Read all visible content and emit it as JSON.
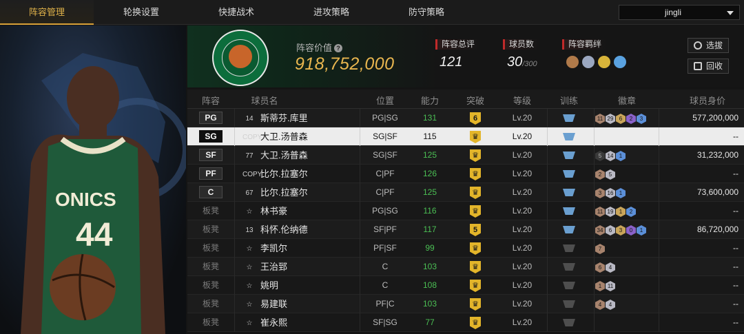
{
  "nav": {
    "tabs": [
      {
        "label": "阵容管理",
        "active": true
      },
      {
        "label": "轮换设置",
        "active": false
      },
      {
        "label": "快捷战术",
        "active": false
      },
      {
        "label": "进攻策略",
        "active": false
      },
      {
        "label": "防守策略",
        "active": false
      }
    ],
    "user": "jingli"
  },
  "header": {
    "value_label": "阵容价值",
    "value": "918,752,000",
    "rating_label": "阵容总评",
    "rating": "121",
    "players_label": "球员数",
    "players": "30",
    "players_max": "/300",
    "bond_label": "阵容羁绊",
    "select_button": "选拔",
    "recycle_button": "回收"
  },
  "table": {
    "headers": [
      "阵容",
      "球员名",
      "位置",
      "能力",
      "突破",
      "等级",
      "训练",
      "徽章",
      "球员身价"
    ],
    "rows": [
      {
        "slot": "PG",
        "starter": true,
        "card": "14",
        "name": "斯蒂芬.库里",
        "role": "PG|SG",
        "ability": "131",
        "ability_color": "green",
        "breakthrough": "6",
        "level": "Lv.20",
        "train": "blue",
        "badges": [
          {
            "c": "bronze",
            "n": "11"
          },
          {
            "c": "silver",
            "n": "29"
          },
          {
            "c": "gold",
            "n": "6"
          },
          {
            "c": "purple",
            "n": "2"
          },
          {
            "c": "blue",
            "n": "3"
          }
        ],
        "value": "577,200,000"
      },
      {
        "slot": "SG",
        "starter": true,
        "selected": true,
        "card": "COPY",
        "name": "大卫.汤普森",
        "role": "SG|SF",
        "ability": "115",
        "ability_color": "white",
        "breakthrough": "",
        "level": "Lv.20",
        "train": "blue",
        "badges": [],
        "value": "--"
      },
      {
        "slot": "SF",
        "starter": true,
        "card": "77",
        "name": "大卫.汤普森",
        "role": "SG|SF",
        "ability": "125",
        "ability_color": "green",
        "breakthrough": "",
        "level": "Lv.20",
        "train": "blue",
        "badges": [
          {
            "c": "dark",
            "n": "5"
          },
          {
            "c": "silver",
            "n": "14"
          },
          {
            "c": "blue",
            "n": "1"
          }
        ],
        "value": "31,232,000"
      },
      {
        "slot": "PF",
        "starter": true,
        "card": "COPY",
        "name": "比尔.拉塞尔",
        "role": "C|PF",
        "ability": "126",
        "ability_color": "green",
        "breakthrough": "",
        "level": "Lv.20",
        "train": "blue",
        "badges": [
          {
            "c": "bronze",
            "n": "2"
          },
          {
            "c": "silver",
            "n": "5"
          }
        ],
        "value": "--"
      },
      {
        "slot": "C",
        "starter": true,
        "card": "67",
        "name": "比尔.拉塞尔",
        "role": "C|PF",
        "ability": "125",
        "ability_color": "green",
        "breakthrough": "",
        "level": "Lv.20",
        "train": "blue",
        "badges": [
          {
            "c": "bronze",
            "n": "3"
          },
          {
            "c": "silver",
            "n": "16"
          },
          {
            "c": "blue",
            "n": "1"
          }
        ],
        "value": "73,600,000"
      },
      {
        "slot": "板凳",
        "starter": false,
        "card": "star",
        "name": "林书豪",
        "role": "PG|SG",
        "ability": "116",
        "ability_color": "green",
        "breakthrough": "",
        "level": "Lv.20",
        "train": "blue",
        "badges": [
          {
            "c": "bronze",
            "n": "11"
          },
          {
            "c": "silver",
            "n": "19"
          },
          {
            "c": "gold",
            "n": "1"
          },
          {
            "c": "blue",
            "n": "2"
          }
        ],
        "value": "--"
      },
      {
        "slot": "板凳",
        "starter": false,
        "card": "13",
        "name": "科怀.伦纳德",
        "role": "SF|PF",
        "ability": "117",
        "ability_color": "green",
        "breakthrough": "5",
        "level": "Lv.20",
        "train": "blue",
        "badges": [
          {
            "c": "bronze",
            "n": "34"
          },
          {
            "c": "silver",
            "n": "6"
          },
          {
            "c": "gold",
            "n": "3"
          },
          {
            "c": "purple",
            "n": "0"
          },
          {
            "c": "blue",
            "n": "1"
          }
        ],
        "value": "86,720,000"
      },
      {
        "slot": "板凳",
        "starter": false,
        "card": "star",
        "name": "李凯尔",
        "role": "PF|SF",
        "ability": "99",
        "ability_color": "green",
        "breakthrough": "",
        "level": "Lv.20",
        "train": "grey",
        "badges": [
          {
            "c": "bronze",
            "n": "7"
          }
        ],
        "value": "--"
      },
      {
        "slot": "板凳",
        "starter": false,
        "card": "star",
        "name": "王治郅",
        "role": "C",
        "ability": "103",
        "ability_color": "green",
        "breakthrough": "",
        "level": "Lv.20",
        "train": "grey",
        "badges": [
          {
            "c": "bronze",
            "n": "6"
          },
          {
            "c": "silver",
            "n": "4"
          }
        ],
        "value": "--"
      },
      {
        "slot": "板凳",
        "starter": false,
        "card": "star",
        "name": "姚明",
        "role": "C",
        "ability": "108",
        "ability_color": "green",
        "breakthrough": "",
        "level": "Lv.20",
        "train": "grey",
        "badges": [
          {
            "c": "bronze",
            "n": "1"
          },
          {
            "c": "silver",
            "n": "11"
          }
        ],
        "value": "--"
      },
      {
        "slot": "板凳",
        "starter": false,
        "card": "star",
        "name": "易建联",
        "role": "PF|C",
        "ability": "103",
        "ability_color": "green",
        "breakthrough": "",
        "level": "Lv.20",
        "train": "grey",
        "badges": [
          {
            "c": "bronze",
            "n": "4"
          },
          {
            "c": "silver",
            "n": "4"
          }
        ],
        "value": "--"
      },
      {
        "slot": "板凳",
        "starter": false,
        "card": "star",
        "name": "崔永熙",
        "role": "SF|SG",
        "ability": "77",
        "ability_color": "green",
        "breakthrough": "",
        "level": "Lv.20",
        "train": "grey",
        "badges": [],
        "value": "--"
      }
    ]
  },
  "colors": {
    "accent": "#e0b24a",
    "positive": "#4bbf54",
    "training": "#6a9fd0"
  },
  "icons": {
    "help": "question-circle-icon",
    "select": "refresh-icon",
    "recycle": "recycle-icon",
    "dropdown": "chevron-down-icon"
  }
}
